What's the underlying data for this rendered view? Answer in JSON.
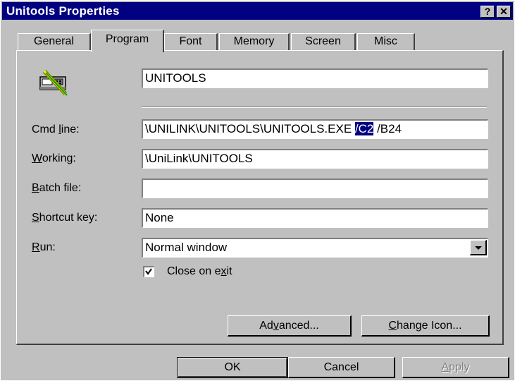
{
  "window": {
    "title": "Unitools Properties"
  },
  "titlebar_buttons": {
    "help": "?",
    "close": "✕"
  },
  "tabs": [
    "General",
    "Program",
    "Font",
    "Memory",
    "Screen",
    "Misc"
  ],
  "program": {
    "name_value": "UNITOOLS",
    "cmd_line": {
      "label_pre": "Cmd ",
      "label_key": "l",
      "label_post": "ine:",
      "value_pre": "\\UNILINK\\UNITOOLS\\UNITOOLS.EXE ",
      "value_selected": "/C2",
      "value_post": " /B24"
    },
    "working": {
      "label_key": "W",
      "label_post": "orking:",
      "value": "\\UniLink\\UNITOOLS"
    },
    "batch_file": {
      "label_key": "B",
      "label_post": "atch file:",
      "value": ""
    },
    "shortcut_key": {
      "label_key": "S",
      "label_post": "hortcut key:",
      "value": "None"
    },
    "run": {
      "label_key": "R",
      "label_post": "un:",
      "value": "Normal window"
    },
    "close_on_exit": {
      "pre": "Close on e",
      "key": "x",
      "post": "it",
      "checked": true
    }
  },
  "panel_buttons": {
    "advanced": {
      "pre": "Ad",
      "key": "v",
      "post": "anced..."
    },
    "change_icon": {
      "pre": "",
      "key": "C",
      "post": "hange Icon..."
    }
  },
  "dialog_buttons": {
    "ok": "OK",
    "cancel": "Cancel",
    "apply": {
      "pre": "",
      "key": "A",
      "post": "pply"
    }
  },
  "colors": {
    "titlebar": "#000080",
    "face": "#c0c0c0",
    "selection": "#000080"
  }
}
